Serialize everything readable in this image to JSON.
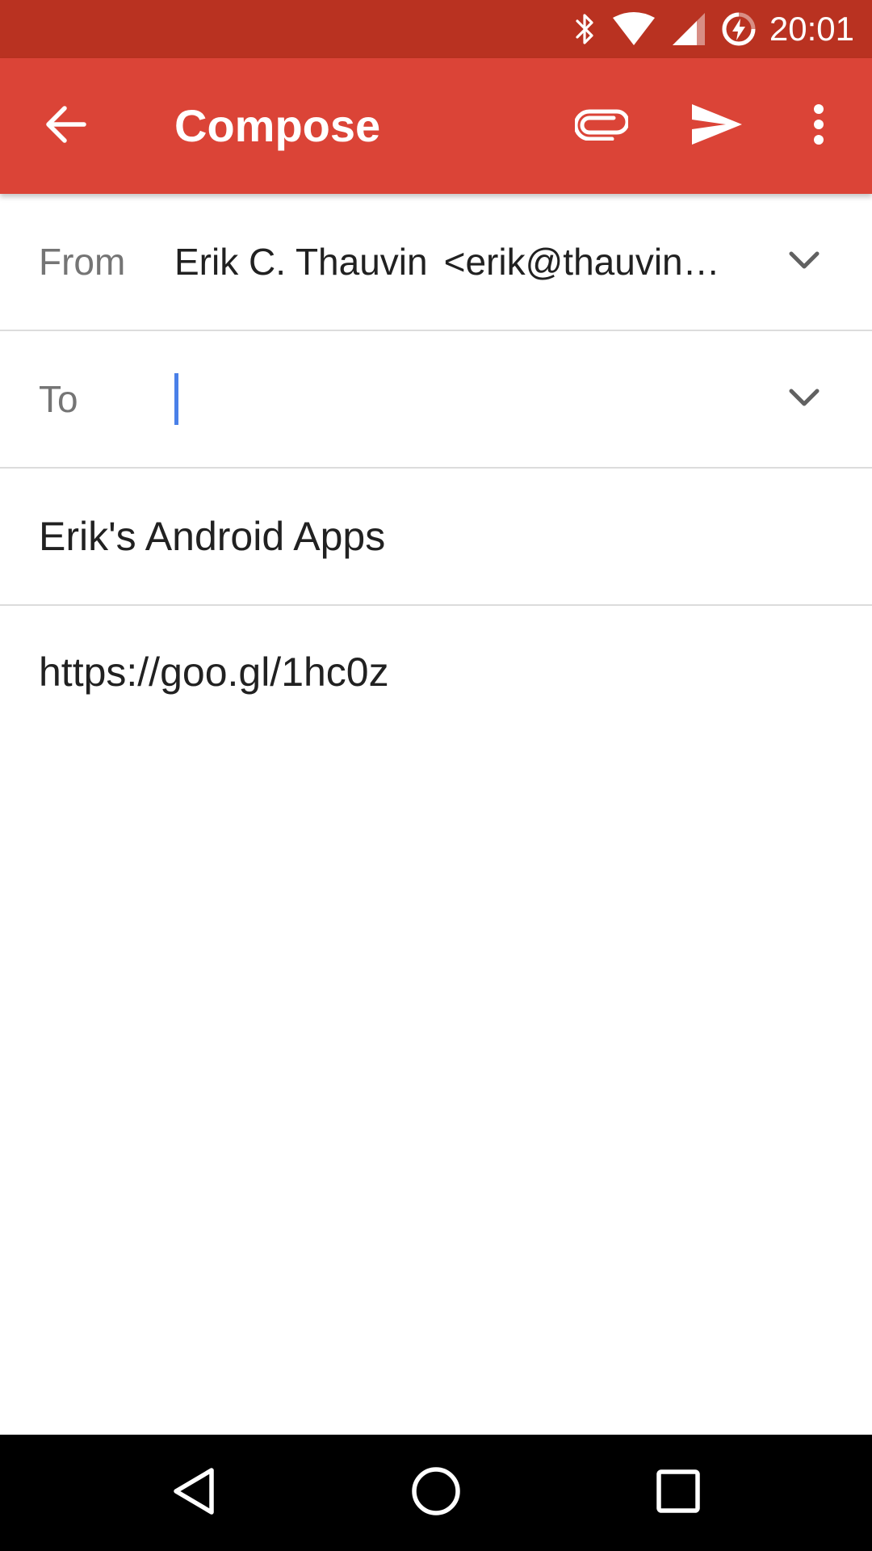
{
  "status_bar": {
    "time": "20:01",
    "icons": [
      "bluetooth-icon",
      "wifi-icon",
      "cell-signal-icon",
      "battery-charging-icon"
    ],
    "background": "#b93221"
  },
  "toolbar": {
    "title": "Compose",
    "background": "#db4437",
    "actions": [
      "back-arrow-icon",
      "attach-icon",
      "send-icon",
      "more-vert-icon"
    ]
  },
  "compose": {
    "from_label": "From",
    "from_name": "Erik C. Thauvin",
    "from_email": "<erik@thauvin…",
    "to_label": "To",
    "to_value": "",
    "subject": "Erik's Android Apps",
    "body": "https://goo.gl/1hc0z"
  },
  "nav_bar": {
    "buttons": [
      "back-nav-icon",
      "home-nav-icon",
      "recents-nav-icon"
    ]
  },
  "colors": {
    "accent_cursor": "#4a80e8",
    "text_primary": "#212121",
    "text_secondary": "#757575",
    "divider": "#dcdcdc"
  }
}
